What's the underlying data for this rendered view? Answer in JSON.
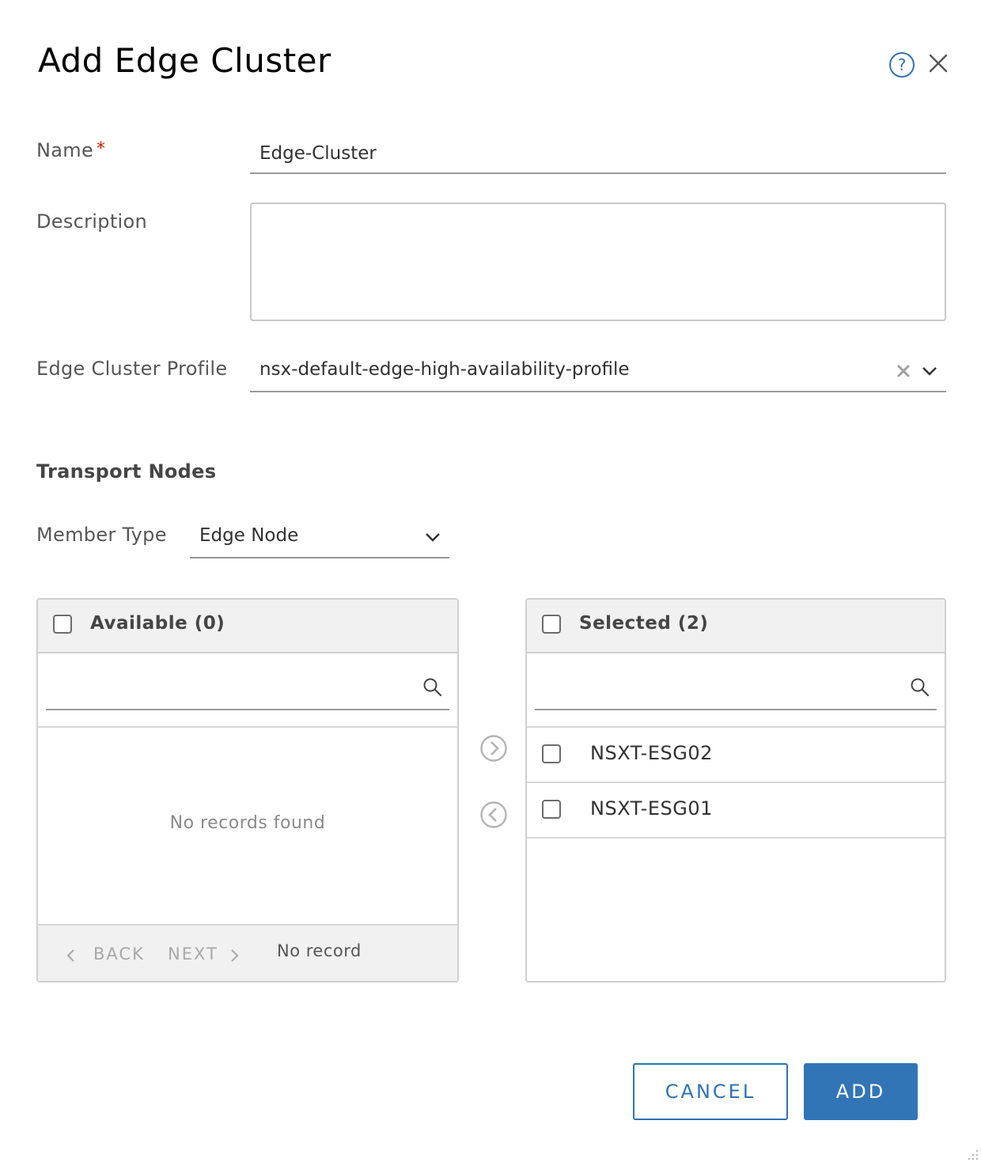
{
  "dialog": {
    "title": "Add Edge Cluster"
  },
  "form": {
    "name_label": "Name",
    "required_marker": "*",
    "name_value": "Edge-Cluster",
    "description_label": "Description",
    "description_value": "",
    "profile_label": "Edge Cluster Profile",
    "profile_value": "nsx-default-edge-high-availability-profile"
  },
  "transport_nodes": {
    "section_title": "Transport Nodes",
    "member_type_label": "Member Type",
    "member_type_value": "Edge Node",
    "available": {
      "title": "Available (0)",
      "search_value": "",
      "empty_text": "No records found",
      "back_label": "BACK",
      "next_label": "NEXT",
      "count_text": "No record"
    },
    "selected": {
      "title": "Selected (2)",
      "search_value": "",
      "items": [
        {
          "label": "NSXT-ESG02"
        },
        {
          "label": "NSXT-ESG01"
        }
      ]
    }
  },
  "footer": {
    "cancel_label": "CANCEL",
    "add_label": "ADD"
  },
  "colors": {
    "primary": "#3275b7",
    "required": "#c92100",
    "panel_header": "#f1f1f1"
  },
  "icons": [
    "help-icon",
    "close-icon",
    "clear-icon",
    "chevron-down-icon",
    "search-icon",
    "chevron-right-circle-icon",
    "chevron-left-circle-icon",
    "chevron-left-icon",
    "chevron-right-icon",
    "resize-grip-icon"
  ]
}
